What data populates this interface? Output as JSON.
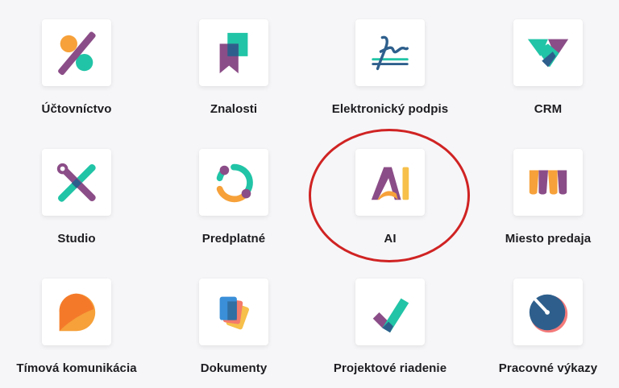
{
  "apps": [
    {
      "label": "Účtovníctvo",
      "icon": "accounting-icon"
    },
    {
      "label": "Znalosti",
      "icon": "knowledge-icon"
    },
    {
      "label": "Elektronický podpis",
      "icon": "signature-icon"
    },
    {
      "label": "CRM",
      "icon": "crm-handshake-icon"
    },
    {
      "label": "Studio",
      "icon": "studio-tools-icon"
    },
    {
      "label": "Predplatné",
      "icon": "subscription-cycle-icon"
    },
    {
      "label": "AI",
      "icon": "ai-icon"
    },
    {
      "label": "Miesto predaja",
      "icon": "point-of-sale-awning-icon"
    },
    {
      "label": "Tímová komunikácia",
      "icon": "team-chat-bubble-icon"
    },
    {
      "label": "Dokumenty",
      "icon": "documents-cards-icon"
    },
    {
      "label": "Projektové riadenie",
      "icon": "project-checkmark-icon"
    },
    {
      "label": "Pracovné výkazy",
      "icon": "timesheet-gauge-icon"
    }
  ],
  "colors": {
    "purple": "#8b4d87",
    "teal": "#21c4a6",
    "orange": "#f6a13a",
    "blue": "#2e5f8c",
    "highlight": "#d02323"
  }
}
